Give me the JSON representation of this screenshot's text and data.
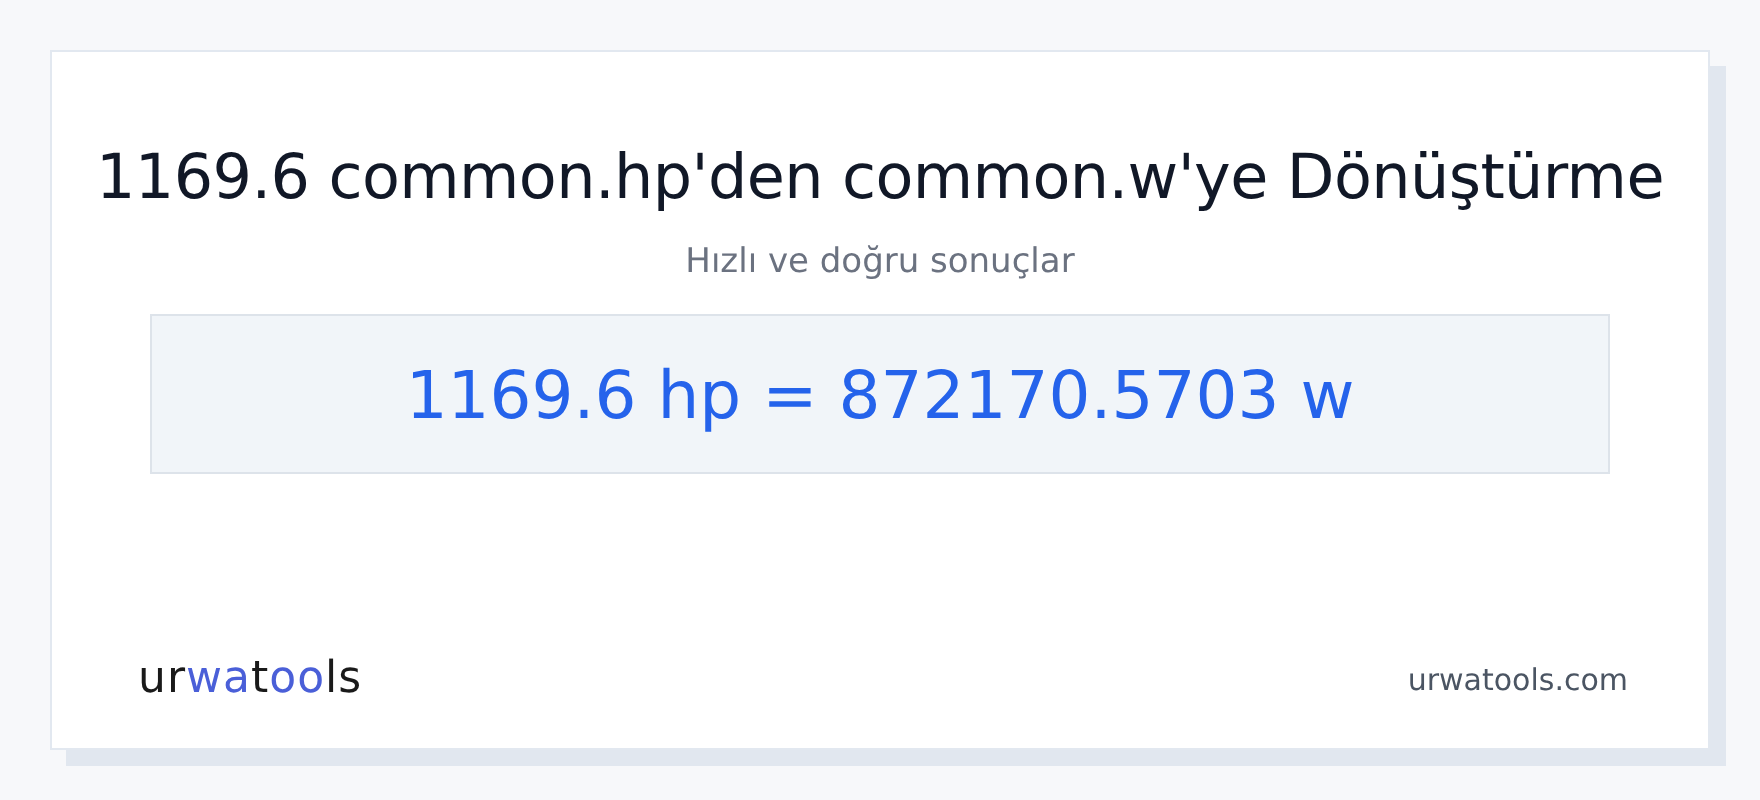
{
  "title": "1169.6 common.hp'den common.w'ye Dönüştürme",
  "subtitle": "Hızlı ve doğru sonuçlar",
  "result": "1169.6 hp = 872170.5703 w",
  "logo": [
    {
      "text": "ur",
      "color": "#1a1a1a"
    },
    {
      "text": "wa",
      "color": "#4a5fd8"
    },
    {
      "text": "t",
      "color": "#1a1a1a"
    },
    {
      "text": "oo",
      "color": "#4a5fd8"
    },
    {
      "text": "ls",
      "color": "#1a1a1a"
    }
  ],
  "site": "urwatools.com"
}
